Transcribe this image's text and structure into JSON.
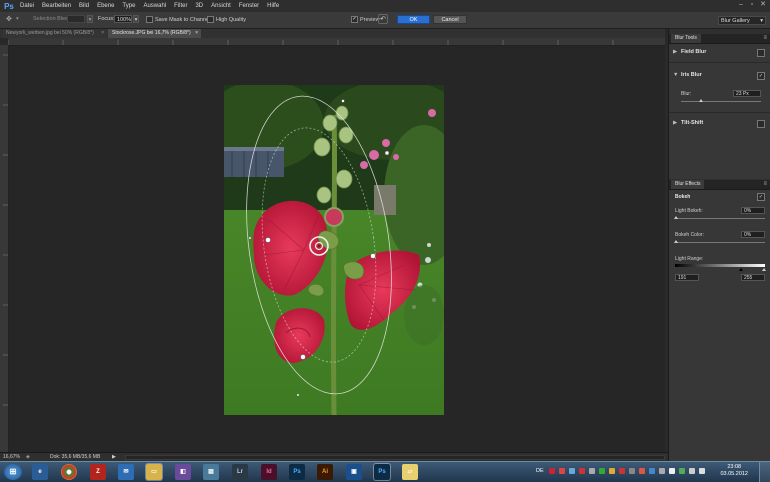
{
  "menubar": {
    "logo": "Ps",
    "items": [
      "Datei",
      "Bearbeiten",
      "Bild",
      "Ebene",
      "Type",
      "Auswahl",
      "Filter",
      "3D",
      "Ansicht",
      "Fenster",
      "Hilfe"
    ]
  },
  "options": {
    "selection_bleed_label": "Selection Bleed:",
    "selection_bleed_value": "",
    "focus_label": "Focus:",
    "focus_value": "100%",
    "save_mask_label": "Save Mask to Channels",
    "high_quality_label": "High Quality",
    "preview_label": "Preview",
    "preview_checked": true,
    "ok_label": "OK",
    "cancel_label": "Cancel",
    "workspace": "Blur Gallery"
  },
  "tabs": [
    {
      "label": "Newyork_werben.jpg bei 50% (RGB/8*)",
      "active": false
    },
    {
      "label": "Stockrose.JPG bei 16,7% (RGB/8*)",
      "active": true
    }
  ],
  "blur_tools": {
    "panel_title": "Blur Tools",
    "field_blur": "Field Blur",
    "iris_blur": "Iris Blur",
    "iris_checked": true,
    "blur_label": "Blur:",
    "blur_value": "23 Px",
    "blur_level": 0.25,
    "tilt_shift": "Tilt-Shift"
  },
  "blur_effects": {
    "panel_title": "Blur Effects",
    "bokeh": "Bokeh",
    "bokeh_checked": true,
    "light_bokeh_label": "Light Bokeh:",
    "light_bokeh_value": "0%",
    "bokeh_color_label": "Bokeh Color:",
    "bokeh_color_value": "0%",
    "light_range_label": "Light Range:",
    "light_range_low": "191",
    "light_range_high": "255"
  },
  "status": {
    "zoom": "16,67%",
    "doc_info": "Dok: 35,6 MB/35,6 MB"
  },
  "taskbar": {
    "icons": [
      "start",
      "ie",
      "chrome",
      "filezilla",
      "thunderbird",
      "explorer",
      "app1",
      "app2",
      "Lr",
      "Id",
      "Ps",
      "Ai",
      "app3",
      "Ps",
      "folder"
    ],
    "lang": "DE",
    "time": "23:08",
    "date": "03.05.2012"
  },
  "colors": {
    "accent_blue": "#2a6fd1",
    "bg": "#282828",
    "panel": "#373737"
  }
}
